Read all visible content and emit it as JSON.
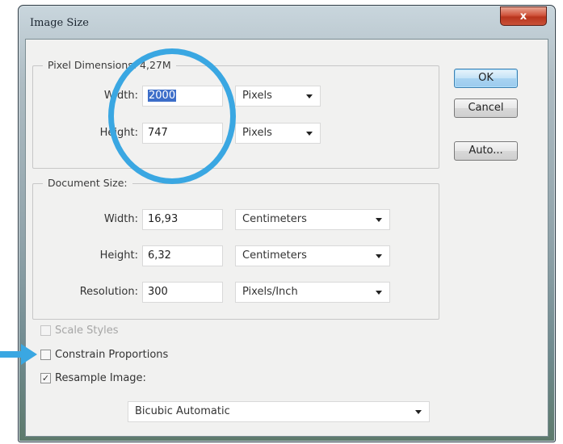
{
  "window": {
    "title": "Image Size",
    "close_label": "x"
  },
  "pixel_dimensions": {
    "label": "Pixel Dimensions: 4,27M",
    "width_label": "Width:",
    "width_value": "2000",
    "width_unit": "Pixels",
    "height_label": "Height:",
    "height_value": "747",
    "height_unit": "Pixels"
  },
  "document_size": {
    "label": "Document Size:",
    "width_label": "Width:",
    "width_value": "16,93",
    "width_unit": "Centimeters",
    "height_label": "Height:",
    "height_value": "6,32",
    "height_unit": "Centimeters",
    "resolution_label": "Resolution:",
    "resolution_value": "300",
    "resolution_unit": "Pixels/Inch"
  },
  "buttons": {
    "ok": "OK",
    "cancel": "Cancel",
    "auto": "Auto..."
  },
  "options": {
    "scale_styles": {
      "label": "Scale Styles",
      "checked": false,
      "enabled": false
    },
    "constrain_proportions": {
      "label": "Constrain Proportions",
      "checked": false,
      "enabled": true
    },
    "resample_image": {
      "label": "Resample Image:",
      "checked": true,
      "enabled": true
    },
    "resample_method": "Bicubic Automatic"
  },
  "colors": {
    "annotation": "#3aa7e2",
    "default_button": "#a8d3f1",
    "selection": "#3d6ec9"
  }
}
